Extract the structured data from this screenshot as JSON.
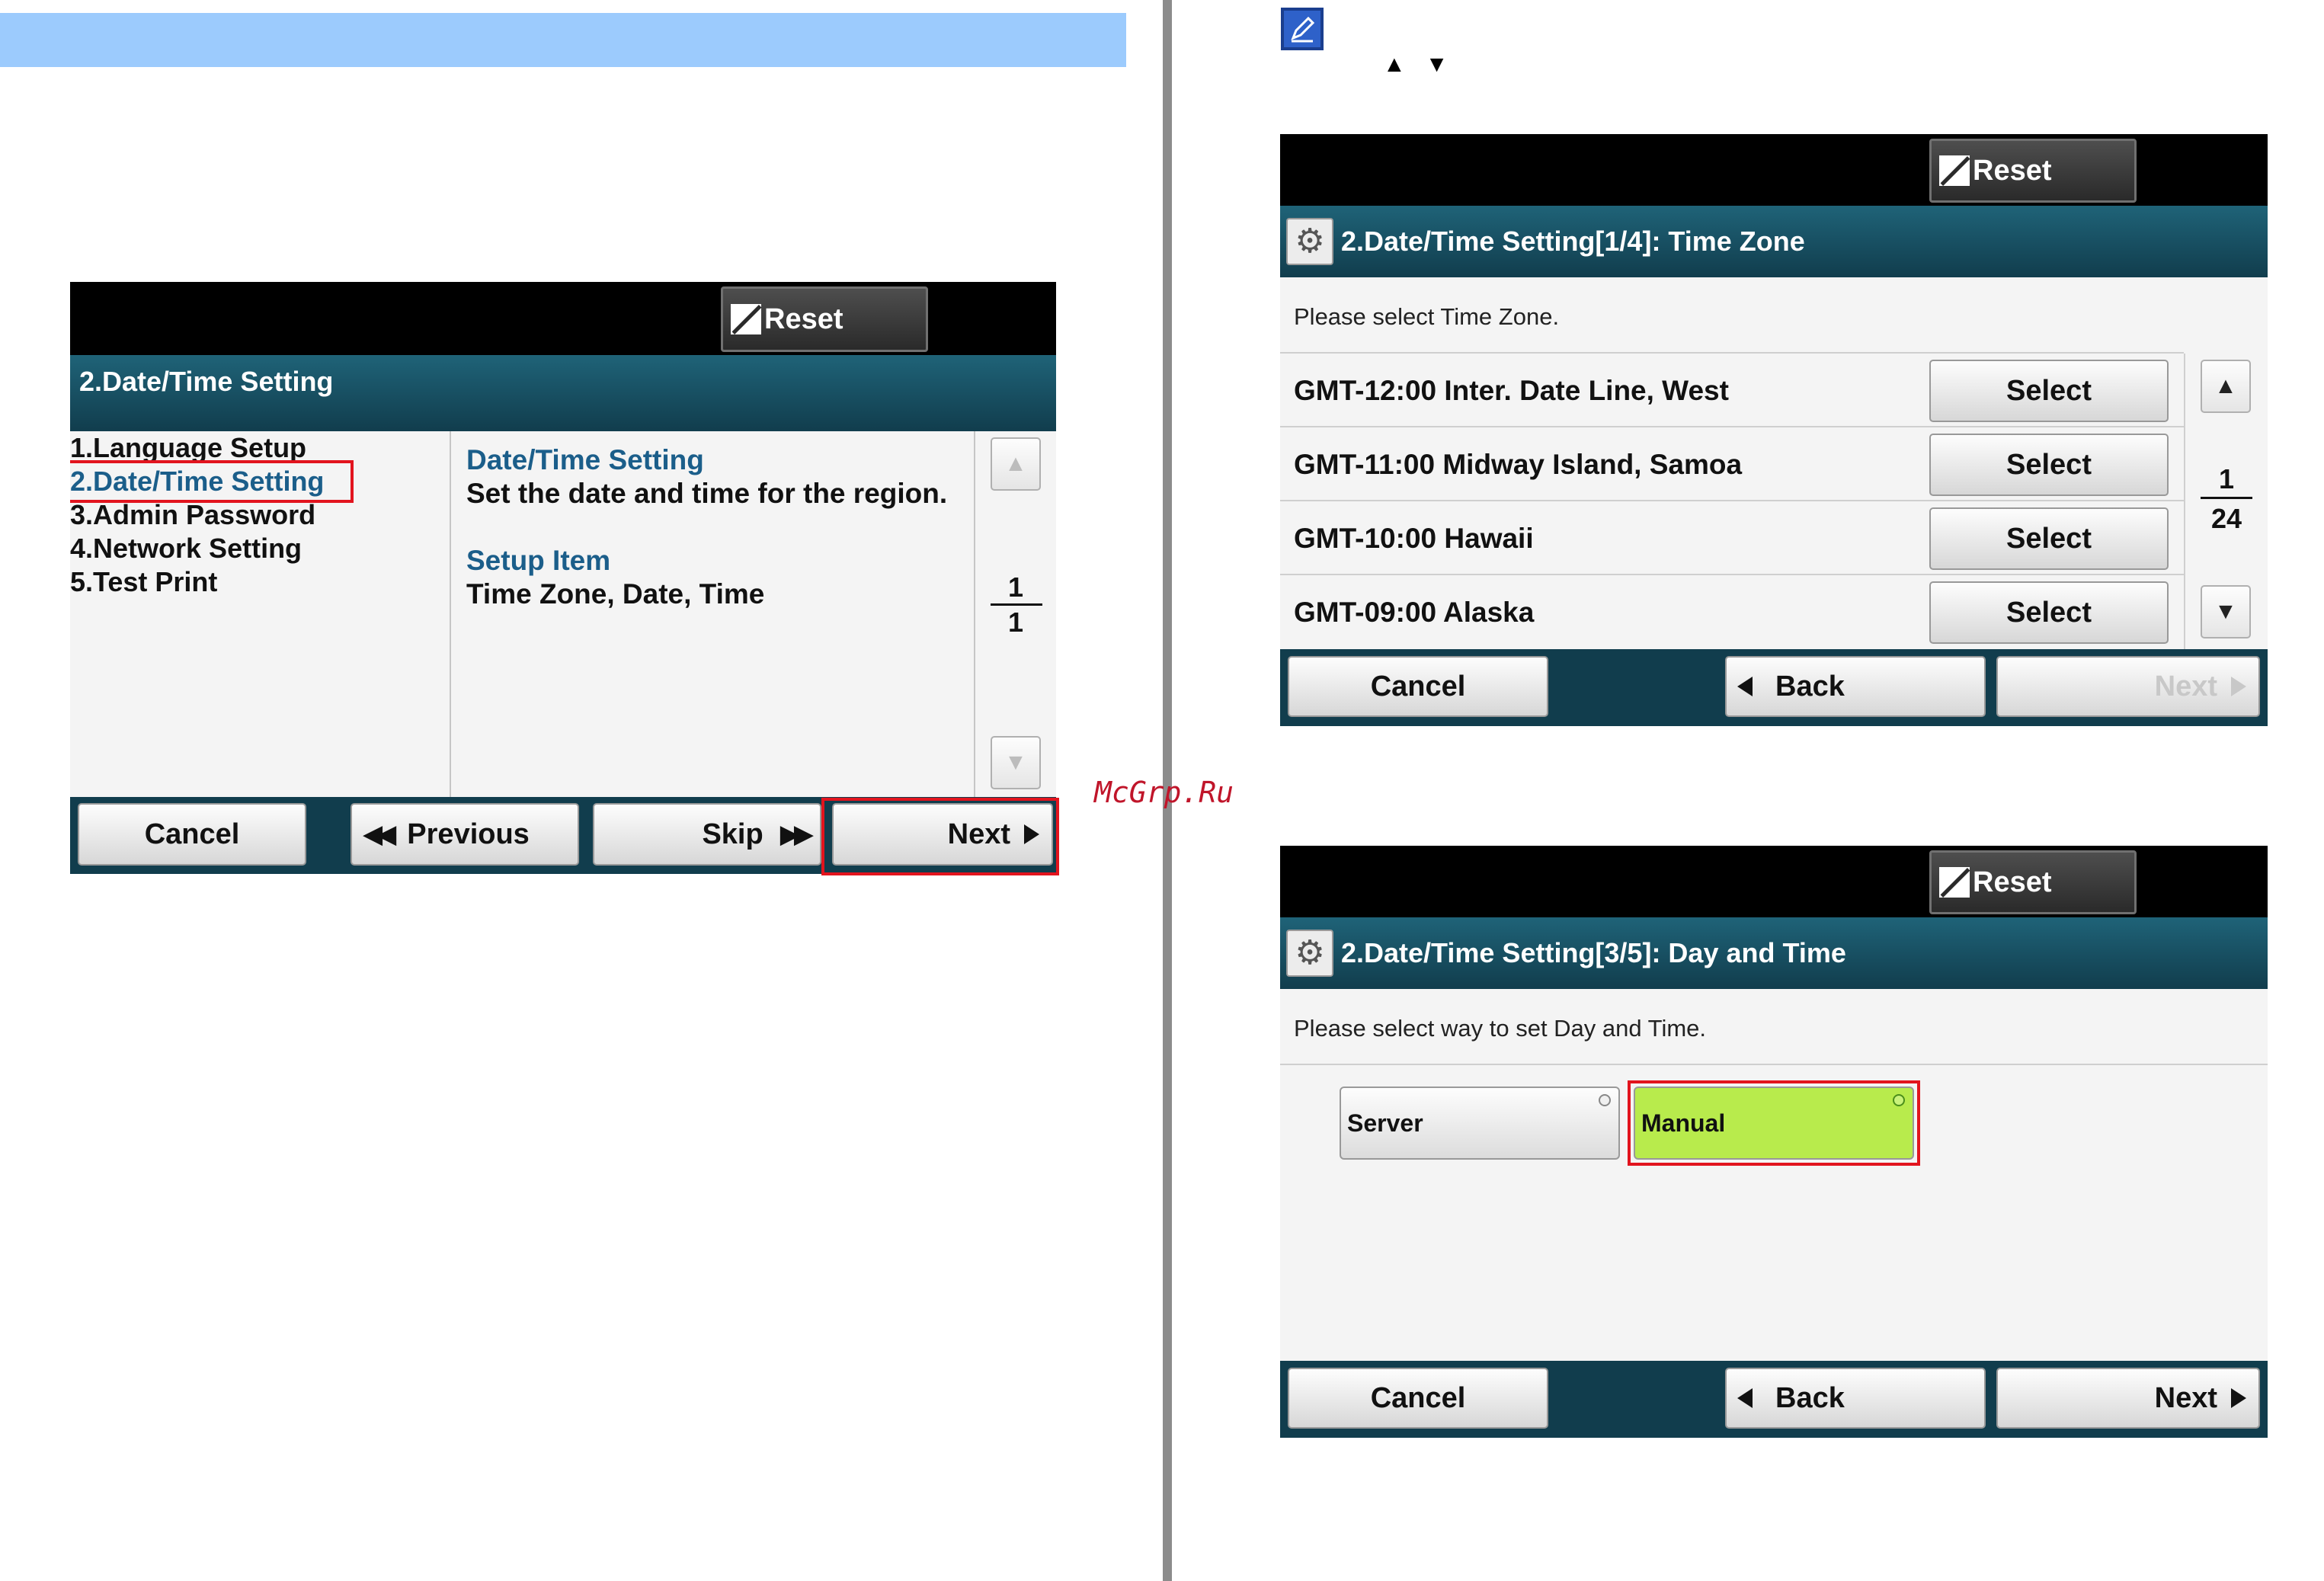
{
  "watermark": "McGrp.Ru",
  "screen1": {
    "reset_label": "Reset",
    "title": "2.Date/Time Setting",
    "menu": [
      "1.Language Setup",
      "2.Date/Time Setting",
      "3.Admin Password",
      "4.Network Setting",
      "5.Test Print"
    ],
    "detail_heading": "Date/Time Setting",
    "detail_text": "Set the date and time for the region.",
    "setup_heading": "Setup Item",
    "setup_text": "Time Zone, Date, Time",
    "page_current": "1",
    "page_total": "1",
    "cancel_label": "Cancel",
    "previous_label": "Previous",
    "skip_label": "Skip",
    "next_label": "Next"
  },
  "screen2": {
    "reset_label": "Reset",
    "title": "2.Date/Time Setting[1/4]: Time Zone",
    "prompt": "Please select Time Zone.",
    "rows": [
      {
        "label": "GMT-12:00 Inter. Date Line, West",
        "button": "Select"
      },
      {
        "label": "GMT-11:00 Midway Island, Samoa",
        "button": "Select"
      },
      {
        "label": "GMT-10:00 Hawaii",
        "button": "Select"
      },
      {
        "label": "GMT-09:00 Alaska",
        "button": "Select"
      }
    ],
    "page_current": "1",
    "page_total": "24",
    "cancel_label": "Cancel",
    "back_label": "Back",
    "next_label": "Next"
  },
  "screen3": {
    "reset_label": "Reset",
    "title": "2.Date/Time Setting[3/5]: Day and Time",
    "prompt": "Please select way to set Day and Time.",
    "option_server": "Server",
    "option_manual": "Manual",
    "cancel_label": "Cancel",
    "back_label": "Back",
    "next_label": "Next"
  }
}
